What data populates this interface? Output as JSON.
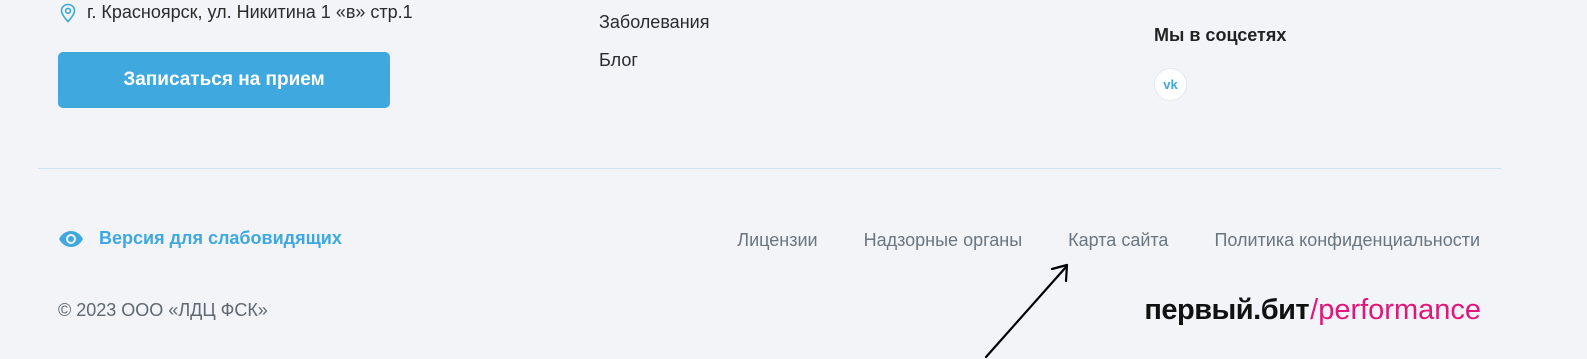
{
  "contacts": {
    "address": "г. Красноярск, ул. Никитина 1 «в» стр.1",
    "address_icon": "location-pin-icon",
    "cta_label": "Записаться на прием"
  },
  "nav": {
    "items": [
      {
        "label": "Заболевания"
      },
      {
        "label": "Блог"
      }
    ]
  },
  "social": {
    "title": "Мы в соцсетях",
    "vk_label": "vk",
    "vk_icon": "vk-icon"
  },
  "footer": {
    "accessibility_label": "Версия для слабовидящих",
    "accessibility_icon": "eye-icon",
    "links": [
      {
        "label": "Лицензии"
      },
      {
        "label": "Надзорные органы"
      },
      {
        "label": "Карта сайта"
      },
      {
        "label": "Политика конфиденциальности"
      }
    ],
    "copyright": "© 2023 ООО «ЛДЦ ФСК»",
    "brand_part1": "первый.бит",
    "brand_part2": "/performance"
  },
  "colors": {
    "background": "#f2f4f8",
    "accent": "#3ea8df",
    "brand_pink": "#e0177a",
    "divider": "#cfe1ef"
  }
}
